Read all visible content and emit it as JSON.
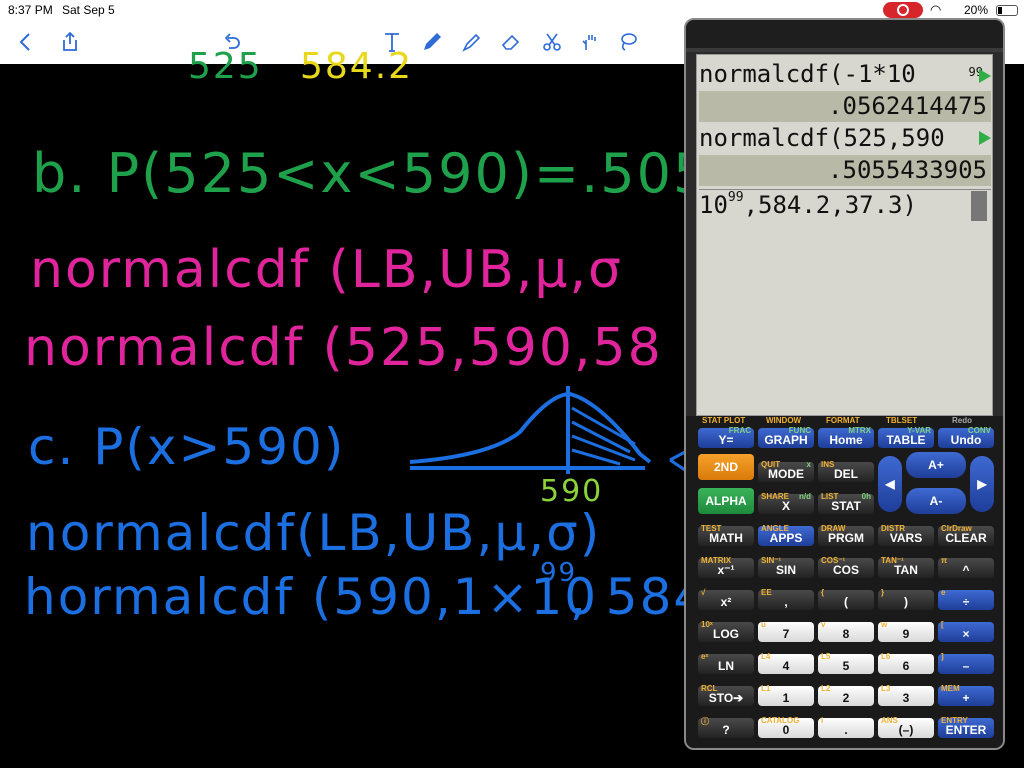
{
  "status": {
    "time": "8:37 PM",
    "date": "Sat Sep 5",
    "battery": "20%"
  },
  "toolbar": {
    "icons": [
      "back-icon",
      "share-icon",
      "undo-icon",
      "text-tool-icon",
      "pen-icon",
      "highlighter-icon",
      "eraser-icon",
      "scissors-icon",
      "hand-icon",
      "lasso-icon"
    ]
  },
  "notes": {
    "top_partial_left": "525",
    "top_partial_right": "584.2",
    "line_b": "b. P(525<x<590)=.5055",
    "line_b_formula": "normalcdf (LB,UB,μ,σ",
    "line_b_values": "normalcdf (525,590,58",
    "line_c": "c. P(x>590)",
    "curve_label": "590",
    "line_c_formula": "normalcdf(LB,UB,μ,σ)",
    "line_c_values_a": "hormalcdf (590,1×10",
    "line_c_exp": "99",
    "line_c_values_b": ", 584"
  },
  "calculator": {
    "screen": {
      "line1": "normalcdf(-1*10",
      "line1_sup": "99",
      "result1": ".0562414475",
      "line2": "normalcdf(525,590",
      "result2": ".5055433905",
      "entry_base": "10",
      "entry_sup": "99",
      "entry_rest": ",584.2,37.3)"
    },
    "top_labels": [
      "STAT PLOT",
      "WINDOW",
      "FORMAT",
      "TBLSET",
      "Redo"
    ],
    "row1": [
      {
        "main": "Y=",
        "sec": "",
        "alph": "FRAC"
      },
      {
        "main": "GRAPH",
        "sec": "",
        "alph": "FUNC"
      },
      {
        "main": "Home",
        "sec": "",
        "alph": "MTRX"
      },
      {
        "main": "TABLE",
        "sec": "",
        "alph": "Y-VAR"
      },
      {
        "main": "Undo",
        "sec": "",
        "alph": "CONV"
      }
    ],
    "row2": [
      {
        "main": "2ND",
        "sec": "",
        "alph": ""
      },
      {
        "main": "MODE",
        "sec": "QUIT",
        "alph": "x"
      },
      {
        "main": "DEL",
        "sec": "INS",
        "alph": ""
      }
    ],
    "row3": [
      {
        "main": "ALPHA",
        "sec": "",
        "alph": ""
      },
      {
        "main": "X",
        "sec": "SHARE",
        "alph": "n/d"
      },
      {
        "main": "STAT",
        "sec": "LIST",
        "alph": "0h"
      }
    ],
    "row4": [
      {
        "main": "MATH",
        "sec": "TEST",
        "alph": ""
      },
      {
        "main": "APPS",
        "sec": "ANGLE",
        "alph": ""
      },
      {
        "main": "PRGM",
        "sec": "DRAW",
        "alph": ""
      },
      {
        "main": "VARS",
        "sec": "DISTR",
        "alph": ""
      },
      {
        "main": "CLEAR",
        "sec": "ClrDraw",
        "alph": ""
      }
    ],
    "row5": [
      {
        "main": "x⁻¹",
        "sec": "MATRIX",
        "alph": ""
      },
      {
        "main": "SIN",
        "sec": "SIN⁻¹",
        "alph": ""
      },
      {
        "main": "COS",
        "sec": "COS⁻¹",
        "alph": ""
      },
      {
        "main": "TAN",
        "sec": "TAN⁻¹",
        "alph": ""
      },
      {
        "main": "^",
        "sec": "π",
        "alph": ""
      }
    ],
    "row6": [
      {
        "main": "x²",
        "sec": "√",
        "alph": ""
      },
      {
        "main": ",",
        "sec": "EE",
        "alph": ""
      },
      {
        "main": "(",
        "sec": "{",
        "alph": ""
      },
      {
        "main": ")",
        "sec": "}",
        "alph": ""
      },
      {
        "main": "÷",
        "sec": "e",
        "alph": ""
      }
    ],
    "row7": [
      {
        "main": "LOG",
        "sec": "10ˣ",
        "alph": ""
      },
      {
        "main": "7",
        "sec": "u",
        "alph": ""
      },
      {
        "main": "8",
        "sec": "v",
        "alph": ""
      },
      {
        "main": "9",
        "sec": "w",
        "alph": ""
      },
      {
        "main": "×",
        "sec": "[",
        "alph": ""
      }
    ],
    "row8": [
      {
        "main": "LN",
        "sec": "eˣ",
        "alph": ""
      },
      {
        "main": "4",
        "sec": "L4",
        "alph": ""
      },
      {
        "main": "5",
        "sec": "L5",
        "alph": ""
      },
      {
        "main": "6",
        "sec": "L6",
        "alph": ""
      },
      {
        "main": "–",
        "sec": "]",
        "alph": ""
      }
    ],
    "row9": [
      {
        "main": "STO➔",
        "sec": "RCL",
        "alph": ""
      },
      {
        "main": "1",
        "sec": "L1",
        "alph": ""
      },
      {
        "main": "2",
        "sec": "L2",
        "alph": ""
      },
      {
        "main": "3",
        "sec": "L3",
        "alph": ""
      },
      {
        "main": "+",
        "sec": "MEM",
        "alph": ""
      }
    ],
    "row10": [
      {
        "main": "?",
        "sec": "ⓘ",
        "alph": ""
      },
      {
        "main": "0",
        "sec": "CATALOG",
        "alph": ""
      },
      {
        "main": ".",
        "sec": "i",
        "alph": ""
      },
      {
        "main": "(–)",
        "sec": "ANS",
        "alph": ""
      },
      {
        "main": "ENTER",
        "sec": "ENTRY",
        "alph": ""
      }
    ],
    "dpad": {
      "up": "A+",
      "down": "A-"
    }
  }
}
